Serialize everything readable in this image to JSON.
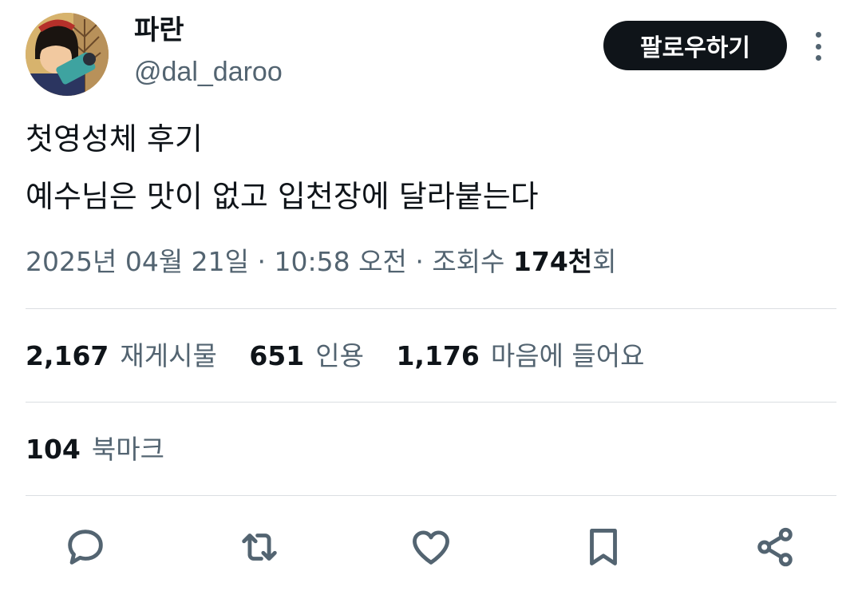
{
  "user": {
    "display_name": "파란",
    "handle": "@dal_daroo",
    "follow_label": "팔로우하기"
  },
  "tweet": {
    "line1": "첫영성체 후기",
    "line2": "예수님은 맛이 없고 입천장에 달라붙는다"
  },
  "meta": {
    "date": "2025년 04월 21일",
    "sep1": " · ",
    "time": "10:58 오전",
    "sep2": " · ",
    "views_prefix": "조회수 ",
    "views_value": "174천",
    "views_suffix": "회"
  },
  "stats": {
    "retweets": {
      "value": "2,167",
      "label": "재게시물"
    },
    "quotes": {
      "value": "651",
      "label": "인용"
    },
    "likes": {
      "value": "1,176",
      "label": "마음에 들어요"
    },
    "bookmarks": {
      "value": "104",
      "label": "북마크"
    }
  },
  "icons": [
    "reply-icon",
    "retweet-icon",
    "like-icon",
    "bookmark-icon",
    "share-icon"
  ],
  "colors": {
    "text": "#0f1419",
    "secondary": "#536471",
    "button": "#0f1419",
    "divider": "#dadee2"
  }
}
